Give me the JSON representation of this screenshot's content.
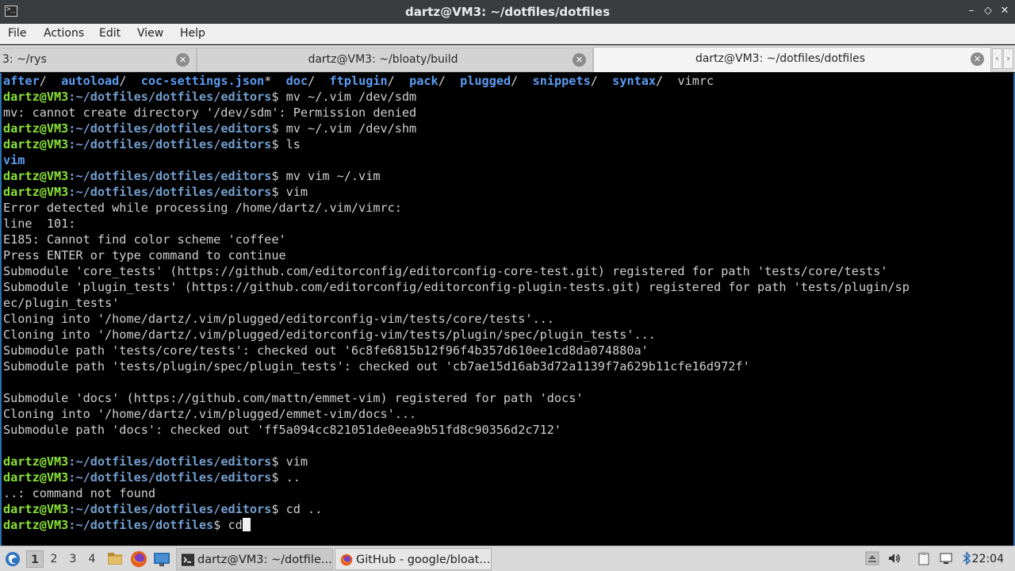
{
  "window": {
    "title": "dartz@VM3: ~/dotfiles/dotfiles",
    "minimize": "–",
    "maximize": "◇",
    "close": "✕"
  },
  "menu": [
    "File",
    "Actions",
    "Edit",
    "View",
    "Help"
  ],
  "tabs": [
    {
      "label": "3: ~/rys",
      "active": false
    },
    {
      "label": "dartz@VM3: ~/bloaty/build",
      "active": false
    },
    {
      "label": "dartz@VM3: ~/dotfiles/dotfiles",
      "active": true
    }
  ],
  "tab_scroll": {
    "left": "‹",
    "right": "›"
  },
  "terminal": {
    "ls_line": [
      {
        "text": "after",
        "dir": true
      },
      {
        "text": "/  ",
        "dir": false
      },
      {
        "text": "autoload",
        "dir": true
      },
      {
        "text": "/  ",
        "dir": false
      },
      {
        "text": "coc-settings.json",
        "dir": true
      },
      {
        "text": "*  ",
        "dir": false
      },
      {
        "text": "doc",
        "dir": true
      },
      {
        "text": "/  ",
        "dir": false
      },
      {
        "text": "ftplugin",
        "dir": true
      },
      {
        "text": "/  ",
        "dir": false
      },
      {
        "text": "pack",
        "dir": true
      },
      {
        "text": "/  ",
        "dir": false
      },
      {
        "text": "plugged",
        "dir": true
      },
      {
        "text": "/  ",
        "dir": false
      },
      {
        "text": "snippets",
        "dir": true
      },
      {
        "text": "/  ",
        "dir": false
      },
      {
        "text": "syntax",
        "dir": true
      },
      {
        "text": "/  ",
        "dir": false
      },
      {
        "text": "vimrc",
        "dir": false
      }
    ],
    "prompt_user": "dartz@VM3",
    "prompt_editors": ":~/dotfiles/dotfiles/editors",
    "prompt_dotfiles": ":~/dotfiles/dotfiles",
    "lines": [
      {
        "type": "prompt",
        "path": "editors",
        "cmd": "$ mv ~/.vim /dev/sdm"
      },
      {
        "type": "text",
        "text": "mv: cannot create directory '/dev/sdm': Permission denied"
      },
      {
        "type": "prompt",
        "path": "editors",
        "cmd": "$ mv ~/.vim /dev/shm"
      },
      {
        "type": "prompt",
        "path": "editors",
        "cmd": "$ ls"
      },
      {
        "type": "dir",
        "text": "vim"
      },
      {
        "type": "prompt",
        "path": "editors",
        "cmd": "$ mv vim ~/.vim"
      },
      {
        "type": "prompt",
        "path": "editors",
        "cmd": "$ vim"
      },
      {
        "type": "text",
        "text": "Error detected while processing /home/dartz/.vim/vimrc:"
      },
      {
        "type": "text",
        "text": "line  101:"
      },
      {
        "type": "text",
        "text": "E185: Cannot find color scheme 'coffee'"
      },
      {
        "type": "text",
        "text": "Press ENTER or type command to continue"
      },
      {
        "type": "text",
        "text": "Submodule 'core_tests' (https://github.com/editorconfig/editorconfig-core-test.git) registered for path 'tests/core/tests'"
      },
      {
        "type": "text",
        "text": "Submodule 'plugin_tests' (https://github.com/editorconfig/editorconfig-plugin-tests.git) registered for path 'tests/plugin/sp"
      },
      {
        "type": "text",
        "text": "ec/plugin_tests'"
      },
      {
        "type": "text",
        "text": "Cloning into '/home/dartz/.vim/plugged/editorconfig-vim/tests/core/tests'..."
      },
      {
        "type": "text",
        "text": "Cloning into '/home/dartz/.vim/plugged/editorconfig-vim/tests/plugin/spec/plugin_tests'..."
      },
      {
        "type": "text",
        "text": "Submodule path 'tests/core/tests': checked out '6c8fe6815b12f96f4b357d610ee1cd8da074880a'"
      },
      {
        "type": "text",
        "text": "Submodule path 'tests/plugin/spec/plugin_tests': checked out 'cb7ae15d16ab3d72a1139f7a629b11cfe16d972f'"
      },
      {
        "type": "text",
        "text": ""
      },
      {
        "type": "text",
        "text": "Submodule 'docs' (https://github.com/mattn/emmet-vim) registered for path 'docs'"
      },
      {
        "type": "text",
        "text": "Cloning into '/home/dartz/.vim/plugged/emmet-vim/docs'..."
      },
      {
        "type": "text",
        "text": "Submodule path 'docs': checked out 'ff5a094cc821051de0eea9b51fd8c90356d2c712'"
      },
      {
        "type": "text",
        "text": ""
      },
      {
        "type": "prompt",
        "path": "editors",
        "cmd": "$ vim"
      },
      {
        "type": "prompt",
        "path": "editors",
        "cmd": "$ .."
      },
      {
        "type": "text",
        "text": "..: command not found"
      },
      {
        "type": "prompt",
        "path": "editors",
        "cmd": "$ cd .."
      },
      {
        "type": "prompt",
        "path": "dotfiles",
        "cmd": "$ cd",
        "cursor": true
      }
    ]
  },
  "taskbar": {
    "workspaces": [
      "1",
      "2",
      "3",
      "4"
    ],
    "tasks": [
      {
        "label": "dartz@VM3: ~/dotfile...",
        "icon": "terminal-icon",
        "active": true
      },
      {
        "label": "GitHub - google/bloat...",
        "icon": "firefox-icon",
        "active": false
      }
    ],
    "clock": "22:04"
  }
}
